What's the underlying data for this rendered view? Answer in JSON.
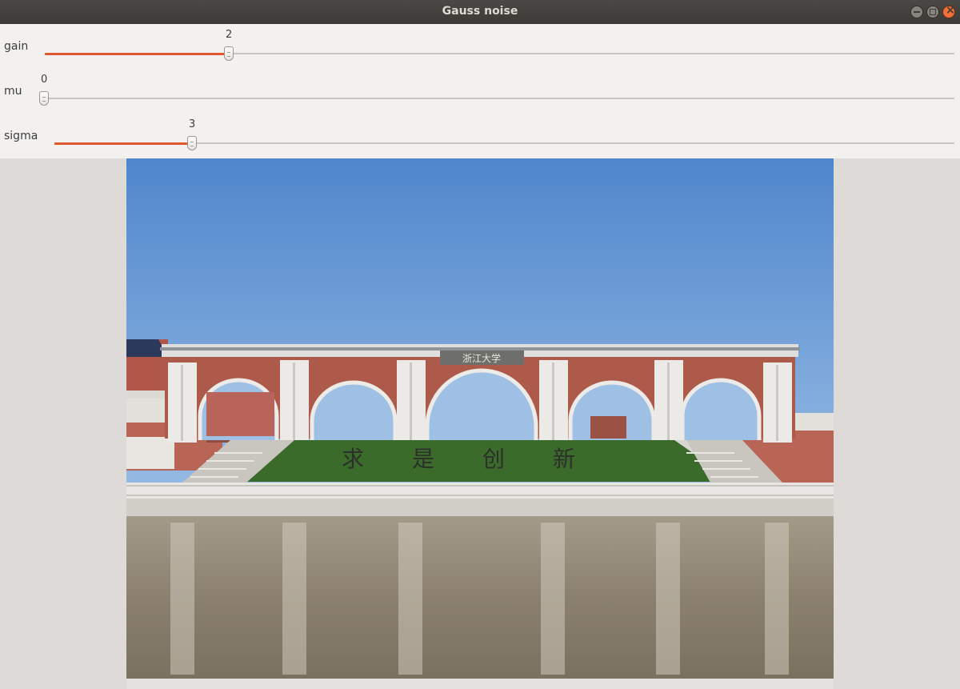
{
  "window": {
    "title": "Gauss noise"
  },
  "sliders": [
    {
      "label": "gain",
      "value": "2",
      "level": 0.203
    },
    {
      "label": "mu",
      "value": "0",
      "level": 0.0
    },
    {
      "label": "sigma",
      "value": "3",
      "level": 0.153
    }
  ],
  "image": {
    "gate_inscription": "浙江大学",
    "lawn_text": "求是创新"
  },
  "colors": {
    "accent": "#e0572e",
    "sky": "#5b8fd0",
    "brick": "#ad5a4b",
    "lawn": "#3a6b2a",
    "water": "#8c8270"
  }
}
